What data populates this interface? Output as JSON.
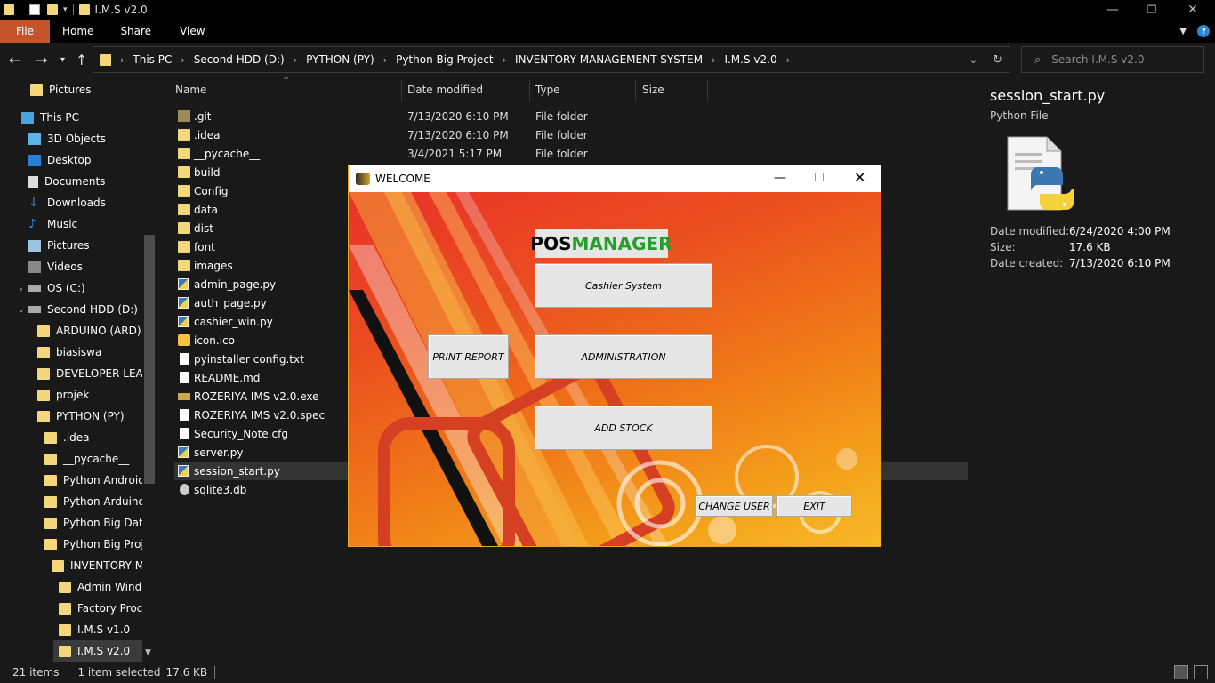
{
  "window": {
    "title": "I.M.S v2.0",
    "min_icon": "—",
    "max_icon": "❐",
    "close_icon": "✕"
  },
  "ribbon": {
    "tabs": [
      "File",
      "Home",
      "Share",
      "View"
    ]
  },
  "address": {
    "crumbs": [
      "This PC",
      "Second HDD (D:)",
      "PYTHON (PY)",
      "Python Big Project",
      "INVENTORY MANAGEMENT SYSTEM",
      "I.M.S v2.0"
    ],
    "search_placeholder": "Search I.M.S v2.0"
  },
  "nav": {
    "items": [
      "Pictures",
      "This PC",
      "3D Objects",
      "Desktop",
      "Documents",
      "Downloads",
      "Music",
      "Pictures",
      "Videos",
      "OS (C:)",
      "Second HDD (D:)",
      "ARDUINO (ARD)",
      "biasiswa",
      "DEVELOPER LEARN",
      "projek",
      "PYTHON (PY)",
      ".idea",
      "__pycache__",
      "Python Android",
      "Python Arduino",
      "Python Big Data a",
      "Python Big Proje",
      "INVENTORY MA",
      "Admin Windo",
      "Factory Proces",
      "I.M.S v1.0",
      "I.M.S v2.0"
    ]
  },
  "columns": {
    "name": "Name",
    "date": "Date modified",
    "type": "Type",
    "size": "Size"
  },
  "files": [
    {
      "name": ".git",
      "date": "7/13/2020 6:10 PM",
      "type": "File folder"
    },
    {
      "name": ".idea",
      "date": "7/13/2020 6:10 PM",
      "type": "File folder"
    },
    {
      "name": "__pycache__",
      "date": "3/4/2021 5:17 PM",
      "type": "File folder"
    },
    {
      "name": "build",
      "date": "",
      "type": ""
    },
    {
      "name": "Config",
      "date": "",
      "type": ""
    },
    {
      "name": "data",
      "date": "",
      "type": ""
    },
    {
      "name": "dist",
      "date": "",
      "type": ""
    },
    {
      "name": "font",
      "date": "",
      "type": ""
    },
    {
      "name": "images",
      "date": "",
      "type": ""
    },
    {
      "name": "admin_page.py",
      "date": "",
      "type": ""
    },
    {
      "name": "auth_page.py",
      "date": "",
      "type": ""
    },
    {
      "name": "cashier_win.py",
      "date": "",
      "type": ""
    },
    {
      "name": "icon.ico",
      "date": "",
      "type": ""
    },
    {
      "name": "pyinstaller config.txt",
      "date": "",
      "type": ""
    },
    {
      "name": "README.md",
      "date": "",
      "type": ""
    },
    {
      "name": "ROZERIYA IMS v2.0.exe",
      "date": "",
      "type": ""
    },
    {
      "name": "ROZERIYA IMS v2.0.spec",
      "date": "",
      "type": ""
    },
    {
      "name": "Security_Note.cfg",
      "date": "",
      "type": ""
    },
    {
      "name": "server.py",
      "date": "",
      "type": ""
    },
    {
      "name": "session_start.py",
      "date": "",
      "type": ""
    },
    {
      "name": "sqlite3.db",
      "date": "",
      "type": ""
    }
  ],
  "details": {
    "filename": "session_start.py",
    "filetype": "Python File",
    "modified_label": "Date modified:",
    "modified_value": "6/24/2020 4:00 PM",
    "size_label": "Size:",
    "size_value": "17.6 KB",
    "created_label": "Date created:",
    "created_value": "7/13/2020 6:10 PM"
  },
  "status": {
    "count": "21 items",
    "selection": "1 item selected",
    "size": "17.6 KB"
  },
  "app": {
    "title": "WELCOME",
    "logo_pos": "POS",
    "logo_manager": "MANAGER",
    "cashier": "Cashier System",
    "print_report": "PRINT REPORT",
    "administration": "ADMINISTRATION",
    "add_stock": "ADD STOCK",
    "change_user": "CHANGE USER",
    "exit": "EXIT"
  },
  "colors": {
    "file_tab": "#c4552a",
    "folder": "#f3d77a",
    "logo_pos": "#000000",
    "logo_manager": "#22a02a"
  }
}
